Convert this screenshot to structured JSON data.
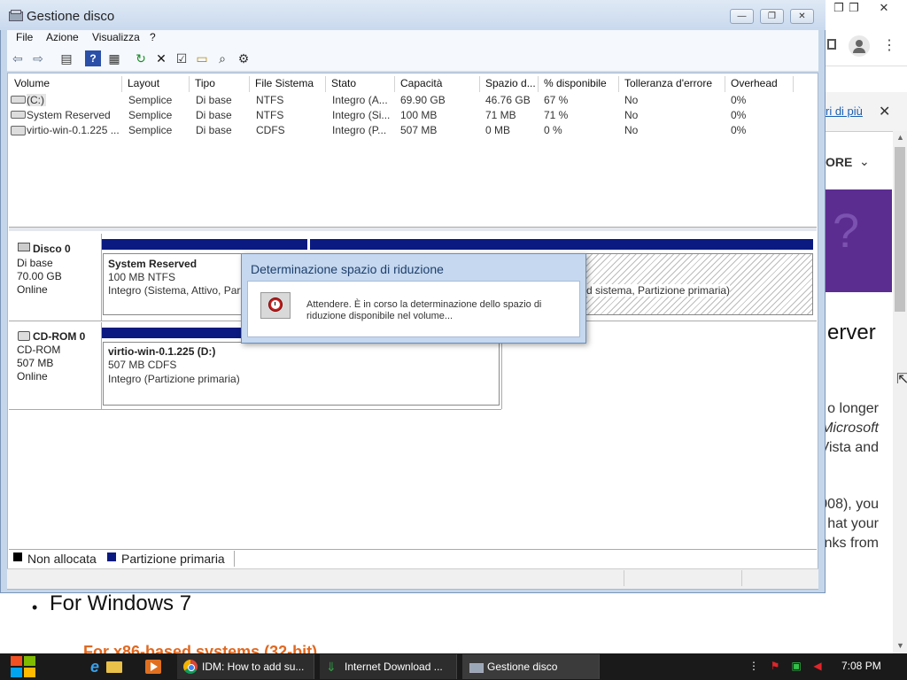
{
  "browser_behind": {
    "window_controls": [
      "❐",
      "❐",
      "✕"
    ],
    "banner_link": "ri di più",
    "nav_more": "ORE",
    "heading_fragment": "erver",
    "paragraph_lines": [
      "o longer",
      "Microsoft",
      "Vista and",
      "008), you",
      "hat your",
      "nks from"
    ],
    "bullet_windows7": "For Windows 7",
    "bullet_x86": "For x86-based systems (32-bit)"
  },
  "window": {
    "title": "Gestione disco",
    "controls": {
      "minimize": "—",
      "maximize": "❐",
      "close": "✕"
    }
  },
  "menu": [
    "File",
    "Azione",
    "Visualizza",
    "?"
  ],
  "toolbar_icons": [
    "back-icon",
    "forward-icon",
    "console-icon",
    "help-icon",
    "properties-icon",
    "refresh-icon",
    "delete-icon",
    "check-icon",
    "open-icon",
    "search-icon",
    "settings-icon"
  ],
  "table": {
    "columns": [
      "Volume",
      "Layout",
      "Tipo",
      "File Sistema",
      "Stato",
      "Capacità",
      "Spazio d...",
      "% disponibile",
      "Tolleranza d'errore",
      "Overhead"
    ],
    "rows": [
      [
        "(C:)",
        "Semplice",
        "Di base",
        "NTFS",
        "Integro (A...",
        "69.90 GB",
        "46.76 GB",
        "67 %",
        "No",
        "0%"
      ],
      [
        "System Reserved",
        "Semplice",
        "Di base",
        "NTFS",
        "Integro (Si...",
        "100 MB",
        "71 MB",
        "71 %",
        "No",
        "0%"
      ],
      [
        "virtio-win-0.1.225 ...",
        "Semplice",
        "Di base",
        "CDFS",
        "Integro (P...",
        "507 MB",
        "0 MB",
        "0 %",
        "No",
        "0%"
      ]
    ]
  },
  "disks": [
    {
      "name": "Disco 0",
      "type": "Di base",
      "size": "70.00 GB",
      "status": "Online"
    },
    {
      "name": "CD-ROM 0",
      "type": "CD-ROM",
      "size": "507 MB",
      "status": "Online"
    }
  ],
  "partitions": {
    "system_reserved": {
      "title": "System Reserved",
      "line1": "100 MB NTFS",
      "line2": "Integro (Sistema, Attivo, Part"
    },
    "c_drive": {
      "line2": "d sistema, Partizione primaria)"
    },
    "virtio": {
      "title": "virtio-win-0.1.225  (D:)",
      "line1": "507 MB CDFS",
      "line2": "Integro (Partizione primaria)"
    }
  },
  "legend": [
    {
      "label": "Non allocata",
      "color": "#000000"
    },
    {
      "label": "Partizione primaria",
      "color": "#0a1a80"
    }
  ],
  "dialog": {
    "title": "Determinazione spazio di riduzione",
    "message": "Attendere. È in corso la determinazione dello spazio di riduzione disponibile nel volume..."
  },
  "taskbar": {
    "tasks": [
      {
        "label": "IDM: How to add su...",
        "icon": "chrome-icon"
      },
      {
        "label": "Internet Download ...",
        "icon": "idm-icon"
      },
      {
        "label": "Gestione disco",
        "icon": "disk-management-icon"
      }
    ],
    "clock": "7:08 PM"
  }
}
